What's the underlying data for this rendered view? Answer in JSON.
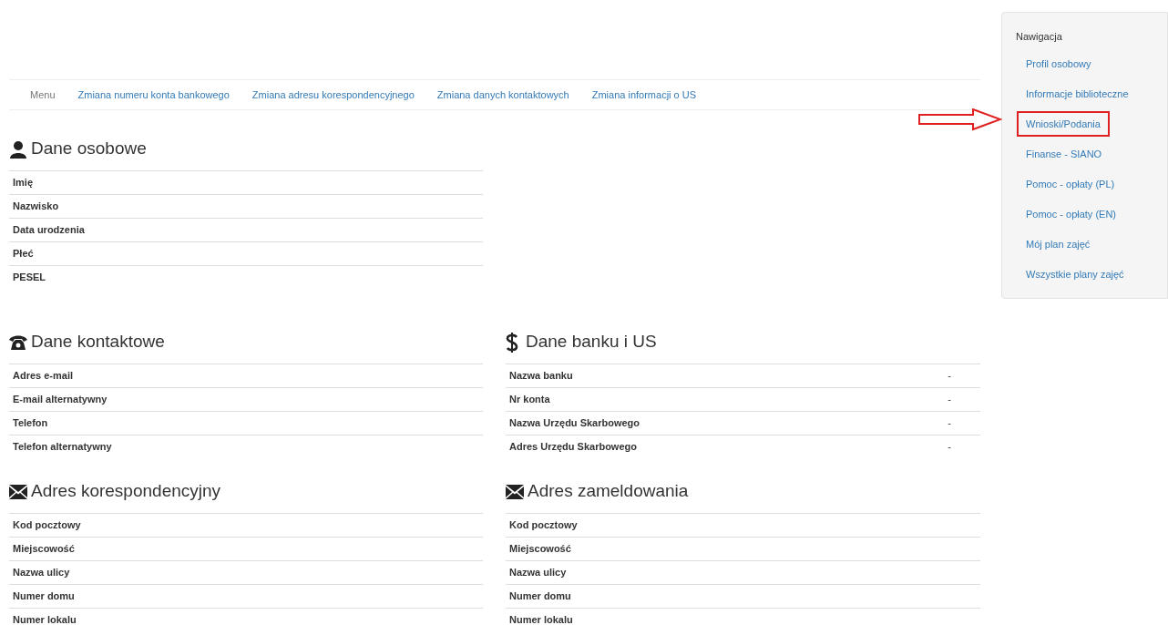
{
  "menu": {
    "label": "Menu",
    "links": [
      "Zmiana numeru konta bankowego",
      "Zmiana adresu korespondencyjnego",
      "Zmiana danych kontaktowych",
      "Zmiana informacji o US"
    ]
  },
  "sections": [
    {
      "kind": "user",
      "title": "Dane osobowe",
      "rows": [
        {
          "label": "Imię"
        },
        {
          "label": "Nazwisko"
        },
        {
          "label": "Data urodzenia"
        },
        {
          "label": "Płeć"
        },
        {
          "label": "PESEL"
        }
      ]
    },
    {
      "kind": "phone",
      "title": "Dane kontaktowe",
      "rows": [
        {
          "label": "Adres e-mail"
        },
        {
          "label": "E-mail alternatywny"
        },
        {
          "label": "Telefon"
        },
        {
          "label": "Telefon alternatywny"
        }
      ]
    },
    {
      "kind": "dollar",
      "title": "Dane banku i US",
      "rows": [
        {
          "label": "Nazwa banku",
          "value": "-"
        },
        {
          "label": "Nr konta",
          "value": "-"
        },
        {
          "label": "Nazwa Urzędu Skarbowego",
          "value": "-"
        },
        {
          "label": "Adres Urzędu Skarbowego",
          "value": "-"
        }
      ]
    },
    {
      "kind": "envelope",
      "title": "Adres korespondencyjny",
      "rows": [
        {
          "label": "Kod pocztowy"
        },
        {
          "label": "Miejscowość"
        },
        {
          "label": "Nazwa ulicy"
        },
        {
          "label": "Numer domu"
        },
        {
          "label": "Numer lokalu"
        }
      ]
    },
    {
      "kind": "envelope",
      "title": "Adres zameldowania",
      "rows": [
        {
          "label": "Kod pocztowy"
        },
        {
          "label": "Miejscowość"
        },
        {
          "label": "Nazwa ulicy"
        },
        {
          "label": "Numer domu"
        },
        {
          "label": "Numer lokalu"
        }
      ]
    }
  ],
  "sidebar": {
    "title": "Nawigacja",
    "items": [
      {
        "label": "Profil osobowy",
        "highlighted": false
      },
      {
        "label": "Informacje biblioteczne",
        "highlighted": false
      },
      {
        "label": "Wnioski/Podania",
        "highlighted": true
      },
      {
        "label": "Finanse - SIANO",
        "highlighted": false
      },
      {
        "label": "Pomoc - opłaty (PL)",
        "highlighted": false
      },
      {
        "label": "Pomoc - opłaty (EN)",
        "highlighted": false
      },
      {
        "label": "Mój plan zajęć",
        "highlighted": false
      },
      {
        "label": "Wszystkie plany zajęć",
        "highlighted": false
      }
    ]
  }
}
